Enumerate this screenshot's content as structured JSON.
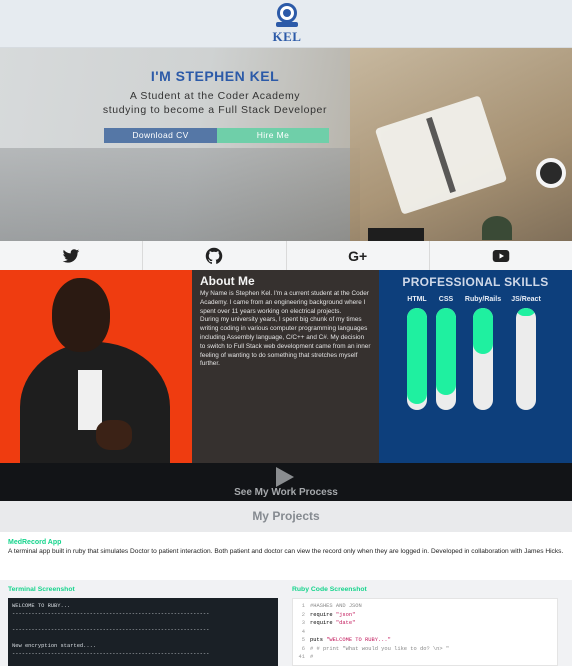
{
  "logo": {
    "text": "KEL",
    "brand_color": "#2c5aa8"
  },
  "hero": {
    "title": "I'M STEPHEN KEL",
    "subtitle_line1": "A Student at the Coder Academy",
    "subtitle_line2": "studying to become a Full Stack Developer",
    "download_label": "Download CV",
    "hire_label": "Hire Me"
  },
  "social": {
    "icons": [
      "twitter-icon",
      "github-icon",
      "google-plus-icon",
      "youtube-icon"
    ],
    "google_plus_text": "G+"
  },
  "about": {
    "heading": "About Me",
    "paragraph1": "My Name is Stephen Kel. I'm a current student at the Coder Academy. I came from an engineering background where I spent over 11 years working on electrical projects.",
    "paragraph2": "During my university years, I spent big chunk of my times writing coding in various computer programming languages including Assembly language, C/C++ and C#. My decision to switch to Full Stack web development came from an inner feeling of wanting to do something that stretches myself further."
  },
  "skills": {
    "heading": "PROFESSIONAL SKILLS",
    "fill_color": "#1ff0a0",
    "items": [
      {
        "label": "HTML",
        "level": 0.94
      },
      {
        "label": "CSS",
        "level": 0.85
      },
      {
        "label": "Ruby/Rails",
        "level": 0.45
      },
      {
        "label": "JS/React",
        "level": 0.08
      }
    ]
  },
  "work": {
    "label": "See My Work Process"
  },
  "projects": {
    "title": "My Projects",
    "item": {
      "name": "MedRecord App",
      "description": "A terminal app built in ruby that simulates Doctor to patient interaction. Both patient and doctor can view the record only when they are logged in. Developed in collaboration with James Hicks."
    }
  },
  "screenshots": {
    "terminal_title": "Terminal Screenshot",
    "terminal_lines": [
      "WELCOME TO RUBY...",
      "-------------------------------------------------------------",
      "",
      "-------------------------------------------------------------",
      "",
      "New encryption started....",
      "-------------------------------------------------------------"
    ],
    "code_title": "Ruby Code Screenshot",
    "code_lines": [
      {
        "num": "1",
        "text": "#HASHES AND JSON",
        "kind": "cmt"
      },
      {
        "num": "2",
        "text": "require \"json\"",
        "kind": "req"
      },
      {
        "num": "3",
        "text": "require \"date\"",
        "kind": "req"
      },
      {
        "num": "4",
        "text": "",
        "kind": "plain"
      },
      {
        "num": "5",
        "text": "puts \"WELCOME TO RUBY...\"",
        "kind": "puts"
      },
      {
        "num": "6",
        "text": "# # print \"What would you like to do? \\n> \"",
        "kind": "cmt"
      },
      {
        "num": "41",
        "text": "#",
        "kind": "cmt"
      }
    ]
  }
}
